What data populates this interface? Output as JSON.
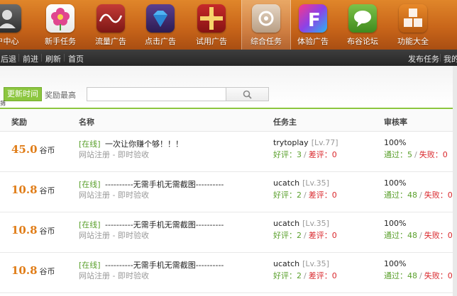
{
  "nav": {
    "items": [
      {
        "label": "户中心",
        "icon": "user-icon"
      },
      {
        "label": "新手任务",
        "icon": "flower-icon"
      },
      {
        "label": "流量广告",
        "icon": "wave-icon"
      },
      {
        "label": "点击广告",
        "icon": "diamond-icon"
      },
      {
        "label": "试用广告",
        "icon": "gift-icon"
      },
      {
        "label": "综合任务",
        "icon": "settings-icon"
      },
      {
        "label": "体验广告",
        "icon": "letter-f-icon"
      },
      {
        "label": "布谷论坛",
        "icon": "chat-icon"
      },
      {
        "label": "功能大全",
        "icon": "cubes-icon"
      }
    ],
    "active_index": 5
  },
  "toolbar": {
    "back": "后退",
    "forward": "前进",
    "refresh": "刷新",
    "home": "首页",
    "publish": "发布任务",
    "mine": "我的"
  },
  "filter": {
    "sort_newest": "更新时间",
    "sort_reward": "奖励最高",
    "search_value": "",
    "tiny_mark": "筛"
  },
  "table": {
    "headers": {
      "reward": "奖励",
      "name": "名称",
      "owner": "任务主",
      "rate": "审核率"
    },
    "rows": [
      {
        "reward": "45.0",
        "unit": "谷币",
        "status": "[在线]",
        "title": "一次让你赚个够！！！",
        "meta": "网站注册 - 即时验收",
        "owner": "trytoplay",
        "level": "[Lv.77]",
        "good_label": "好评：",
        "good": "3",
        "bad_label": "差评：",
        "bad": "0",
        "rate": "100%",
        "pass_label": "通过：",
        "pass": "5",
        "fail_label": "失败：",
        "fail": "0"
      },
      {
        "reward": "10.8",
        "unit": "谷币",
        "status": "[在线]",
        "title": "----------无需手机无需截图----------",
        "meta": "网站注册 - 即时验收",
        "owner": "ucatch",
        "level": "[Lv.35]",
        "good_label": "好评：",
        "good": "2",
        "bad_label": "差评：",
        "bad": "0",
        "rate": "100%",
        "pass_label": "通过：",
        "pass": "48",
        "fail_label": "失败：",
        "fail": "0"
      },
      {
        "reward": "10.8",
        "unit": "谷币",
        "status": "[在线]",
        "title": "----------无需手机无需截图----------",
        "meta": "网站注册 - 即时验收",
        "owner": "ucatch",
        "level": "[Lv.35]",
        "good_label": "好评：",
        "good": "2",
        "bad_label": "差评：",
        "bad": "0",
        "rate": "100%",
        "pass_label": "通过：",
        "pass": "48",
        "fail_label": "失败：",
        "fail": "0"
      },
      {
        "reward": "10.8",
        "unit": "谷币",
        "status": "[在线]",
        "title": "----------无需手机无需截图----------",
        "meta": "网站注册 - 即时验收",
        "owner": "ucatch",
        "level": "[Lv.35]",
        "good_label": "好评：",
        "good": "2",
        "bad_label": "差评：",
        "bad": "0",
        "rate": "100%",
        "pass_label": "通过：",
        "pass": "48",
        "fail_label": "失败：",
        "fail": "0"
      }
    ]
  },
  "colors": {
    "accent_green": "#8cc63f",
    "reward_orange": "#e07d18",
    "bad_red": "#d9262b",
    "topbar_orange": "#c9661a"
  }
}
